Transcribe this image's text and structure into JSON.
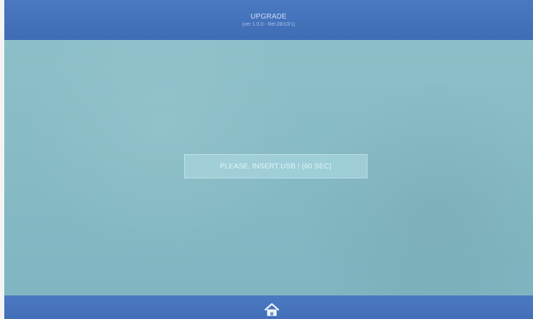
{
  "header": {
    "title": "UPGRADE",
    "subtitle": "[ver 1.0.0 - Rel.28/10/1]"
  },
  "content": {
    "message": "PLEASE, INSERT USB ! (60 sec)"
  },
  "footer": {
    "home_icon": "home-icon"
  },
  "colors": {
    "header_blue": "#4a78c1",
    "content_blue": "#8dbfc9",
    "message_text": "#e6f5f8"
  }
}
